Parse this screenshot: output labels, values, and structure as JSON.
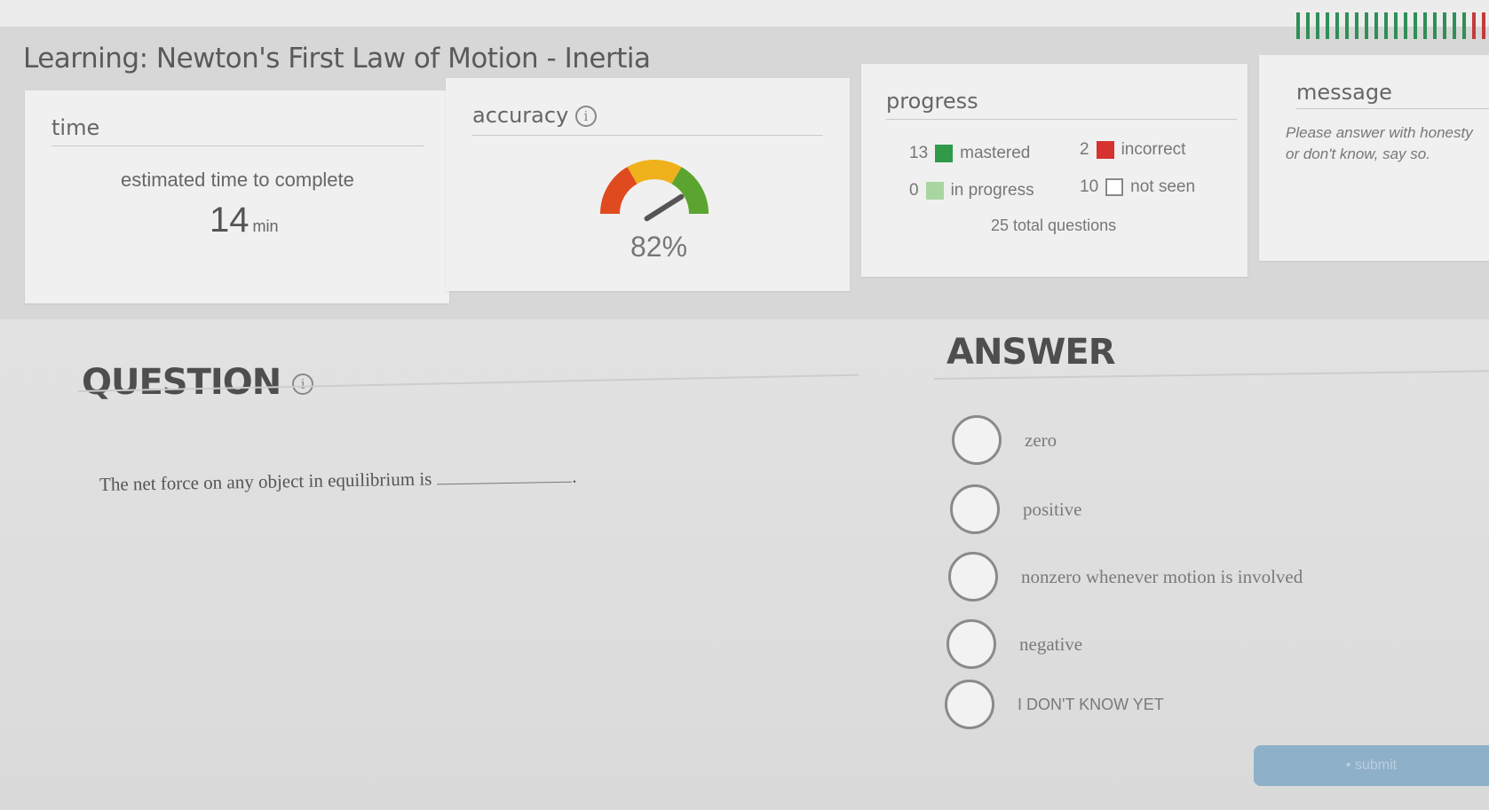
{
  "page": {
    "title": "Learning: Newton's First Law of Motion - Inertia"
  },
  "time_card": {
    "title": "time",
    "subtitle": "estimated time to complete",
    "value": "14",
    "unit": "min"
  },
  "accuracy_card": {
    "title": "accuracy",
    "info_glyph": "i",
    "value": "82%",
    "gauge_value": 0.82,
    "gauge_colors": [
      "#e04a1f",
      "#f0b21c",
      "#5ba42f"
    ]
  },
  "progress_card": {
    "title": "progress",
    "mastered": {
      "count": "13",
      "label": "mastered",
      "color": "#2f9b4a"
    },
    "incorrect": {
      "count": "2",
      "label": "incorrect",
      "color": "#d6322f"
    },
    "in_progress": {
      "count": "0",
      "label": "in progress",
      "color": "#a9d6a0"
    },
    "not_seen": {
      "count": "10",
      "label": "not seen",
      "color": "#ffffff"
    },
    "total": "25 total questions"
  },
  "message_card": {
    "title": "message",
    "line1": "Please answer with honesty",
    "line2": "or don't know, say so."
  },
  "question": {
    "heading": "QUESTION",
    "info_glyph": "i",
    "text": "The net force on any object in equilibrium is",
    "end": "."
  },
  "answer": {
    "heading": "ANSWER",
    "options": [
      {
        "label": "zero"
      },
      {
        "label": "positive"
      },
      {
        "label": "nonzero whenever motion is involved"
      },
      {
        "label": "negative"
      },
      {
        "label": "I DON'T KNOW YET"
      }
    ]
  },
  "submit": {
    "label": "• submit"
  }
}
